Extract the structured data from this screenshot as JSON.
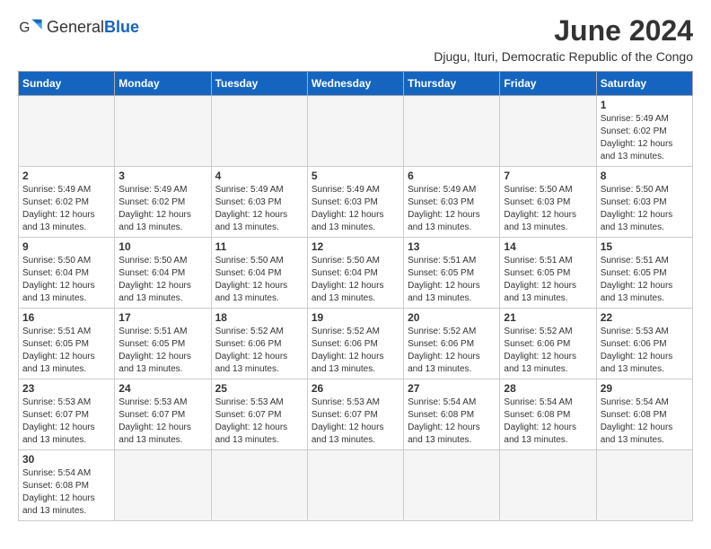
{
  "header": {
    "logo_general": "General",
    "logo_blue": "Blue",
    "month_title": "June 2024",
    "subtitle": "Djugu, Ituri, Democratic Republic of the Congo"
  },
  "days_of_week": [
    "Sunday",
    "Monday",
    "Tuesday",
    "Wednesday",
    "Thursday",
    "Friday",
    "Saturday"
  ],
  "weeks": [
    [
      {
        "day": null
      },
      {
        "day": null
      },
      {
        "day": null
      },
      {
        "day": null
      },
      {
        "day": null
      },
      {
        "day": null
      },
      {
        "day": 1,
        "sunrise": "5:49 AM",
        "sunset": "6:02 PM",
        "daylight": "12 hours and 13 minutes."
      }
    ],
    [
      {
        "day": 2,
        "sunrise": "5:49 AM",
        "sunset": "6:02 PM",
        "daylight": "12 hours and 13 minutes."
      },
      {
        "day": 3,
        "sunrise": "5:49 AM",
        "sunset": "6:02 PM",
        "daylight": "12 hours and 13 minutes."
      },
      {
        "day": 4,
        "sunrise": "5:49 AM",
        "sunset": "6:03 PM",
        "daylight": "12 hours and 13 minutes."
      },
      {
        "day": 5,
        "sunrise": "5:49 AM",
        "sunset": "6:03 PM",
        "daylight": "12 hours and 13 minutes."
      },
      {
        "day": 6,
        "sunrise": "5:49 AM",
        "sunset": "6:03 PM",
        "daylight": "12 hours and 13 minutes."
      },
      {
        "day": 7,
        "sunrise": "5:50 AM",
        "sunset": "6:03 PM",
        "daylight": "12 hours and 13 minutes."
      },
      {
        "day": 8,
        "sunrise": "5:50 AM",
        "sunset": "6:03 PM",
        "daylight": "12 hours and 13 minutes."
      }
    ],
    [
      {
        "day": 9,
        "sunrise": "5:50 AM",
        "sunset": "6:04 PM",
        "daylight": "12 hours and 13 minutes."
      },
      {
        "day": 10,
        "sunrise": "5:50 AM",
        "sunset": "6:04 PM",
        "daylight": "12 hours and 13 minutes."
      },
      {
        "day": 11,
        "sunrise": "5:50 AM",
        "sunset": "6:04 PM",
        "daylight": "12 hours and 13 minutes."
      },
      {
        "day": 12,
        "sunrise": "5:50 AM",
        "sunset": "6:04 PM",
        "daylight": "12 hours and 13 minutes."
      },
      {
        "day": 13,
        "sunrise": "5:51 AM",
        "sunset": "6:05 PM",
        "daylight": "12 hours and 13 minutes."
      },
      {
        "day": 14,
        "sunrise": "5:51 AM",
        "sunset": "6:05 PM",
        "daylight": "12 hours and 13 minutes."
      },
      {
        "day": 15,
        "sunrise": "5:51 AM",
        "sunset": "6:05 PM",
        "daylight": "12 hours and 13 minutes."
      }
    ],
    [
      {
        "day": 16,
        "sunrise": "5:51 AM",
        "sunset": "6:05 PM",
        "daylight": "12 hours and 13 minutes."
      },
      {
        "day": 17,
        "sunrise": "5:51 AM",
        "sunset": "6:05 PM",
        "daylight": "12 hours and 13 minutes."
      },
      {
        "day": 18,
        "sunrise": "5:52 AM",
        "sunset": "6:06 PM",
        "daylight": "12 hours and 13 minutes."
      },
      {
        "day": 19,
        "sunrise": "5:52 AM",
        "sunset": "6:06 PM",
        "daylight": "12 hours and 13 minutes."
      },
      {
        "day": 20,
        "sunrise": "5:52 AM",
        "sunset": "6:06 PM",
        "daylight": "12 hours and 13 minutes."
      },
      {
        "day": 21,
        "sunrise": "5:52 AM",
        "sunset": "6:06 PM",
        "daylight": "12 hours and 13 minutes."
      },
      {
        "day": 22,
        "sunrise": "5:53 AM",
        "sunset": "6:06 PM",
        "daylight": "12 hours and 13 minutes."
      }
    ],
    [
      {
        "day": 23,
        "sunrise": "5:53 AM",
        "sunset": "6:07 PM",
        "daylight": "12 hours and 13 minutes."
      },
      {
        "day": 24,
        "sunrise": "5:53 AM",
        "sunset": "6:07 PM",
        "daylight": "12 hours and 13 minutes."
      },
      {
        "day": 25,
        "sunrise": "5:53 AM",
        "sunset": "6:07 PM",
        "daylight": "12 hours and 13 minutes."
      },
      {
        "day": 26,
        "sunrise": "5:53 AM",
        "sunset": "6:07 PM",
        "daylight": "12 hours and 13 minutes."
      },
      {
        "day": 27,
        "sunrise": "5:54 AM",
        "sunset": "6:08 PM",
        "daylight": "12 hours and 13 minutes."
      },
      {
        "day": 28,
        "sunrise": "5:54 AM",
        "sunset": "6:08 PM",
        "daylight": "12 hours and 13 minutes."
      },
      {
        "day": 29,
        "sunrise": "5:54 AM",
        "sunset": "6:08 PM",
        "daylight": "12 hours and 13 minutes."
      }
    ],
    [
      {
        "day": 30,
        "sunrise": "5:54 AM",
        "sunset": "6:08 PM",
        "daylight": "12 hours and 13 minutes."
      },
      {
        "day": null
      },
      {
        "day": null
      },
      {
        "day": null
      },
      {
        "day": null
      },
      {
        "day": null
      },
      {
        "day": null
      }
    ]
  ],
  "labels": {
    "sunrise": "Sunrise:",
    "sunset": "Sunset:",
    "daylight": "Daylight:"
  }
}
